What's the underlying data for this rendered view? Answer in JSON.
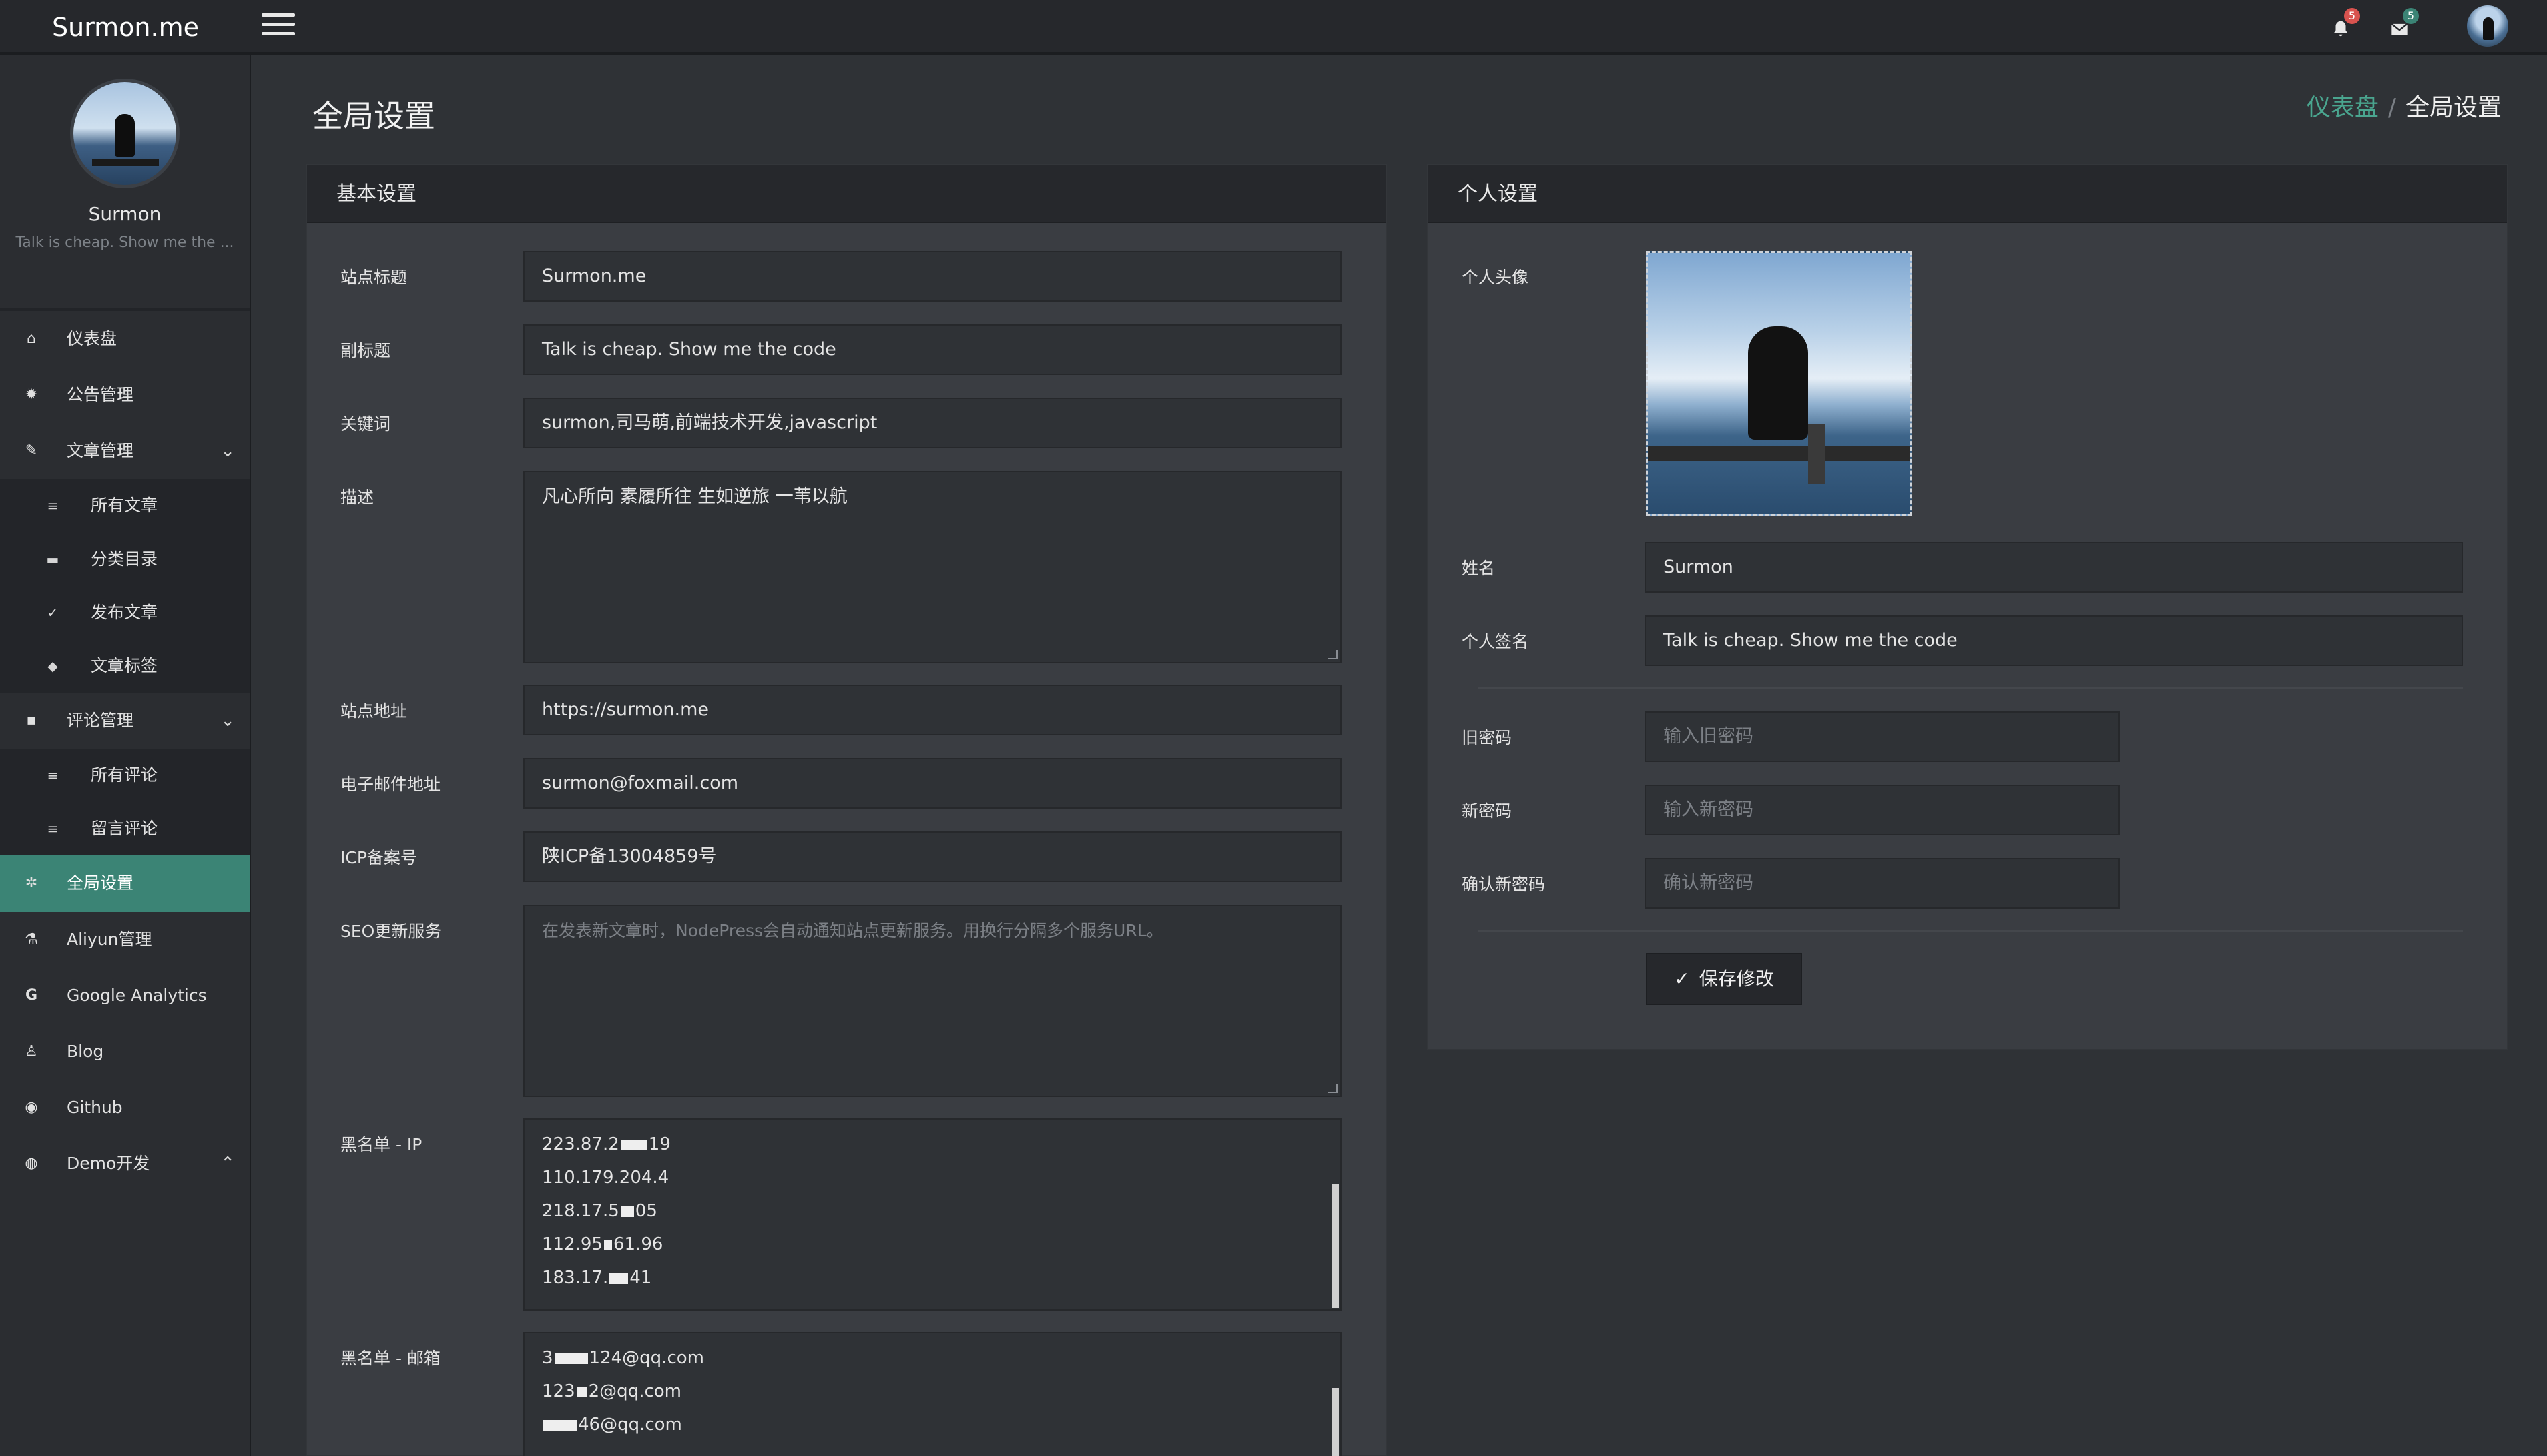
{
  "app": {
    "brand": "Surmon.me"
  },
  "topbar": {
    "notifications_count": "5",
    "messages_count": "5"
  },
  "sidebar": {
    "profile": {
      "name": "Surmon",
      "slogan": "Talk is cheap. Show me the ..."
    },
    "items": [
      {
        "label": "仪表盘",
        "icon": "home-icon"
      },
      {
        "label": "公告管理",
        "icon": "sun-icon"
      },
      {
        "label": "文章管理",
        "icon": "pencil-icon"
      },
      {
        "label": "所有文章",
        "icon": "list-icon"
      },
      {
        "label": "分类目录",
        "icon": "folder-icon"
      },
      {
        "label": "发布文章",
        "icon": "check-icon"
      },
      {
        "label": "文章标签",
        "icon": "tag-icon"
      },
      {
        "label": "评论管理",
        "icon": "comment-icon"
      },
      {
        "label": "所有评论",
        "icon": "list-icon"
      },
      {
        "label": "留言评论",
        "icon": "list-icon"
      },
      {
        "label": "全局设置",
        "icon": "gear-icon"
      },
      {
        "label": "Aliyun管理",
        "icon": "flask-icon"
      },
      {
        "label": "Google Analytics",
        "icon": "google-icon"
      },
      {
        "label": "Blog",
        "icon": "user-icon"
      },
      {
        "label": "Github",
        "icon": "github-icon"
      },
      {
        "label": "Demo开发",
        "icon": "chrome-icon"
      }
    ]
  },
  "page": {
    "title": "全局设置",
    "breadcrumb": {
      "home": "仪表盘",
      "current": "全局设置"
    }
  },
  "basic": {
    "heading": "基本设置",
    "site_title": {
      "label": "站点标题",
      "value": "Surmon.me"
    },
    "subtitle": {
      "label": "副标题",
      "value": "Talk is cheap. Show me the code"
    },
    "keywords": {
      "label": "关键词",
      "value": "surmon,司马萌,前端技术开发,javascript"
    },
    "description": {
      "label": "描述",
      "value": "凡心所向 素履所往 生如逆旅 一苇以航"
    },
    "site_url": {
      "label": "站点地址",
      "value": "https://surmon.me"
    },
    "email": {
      "label": "电子邮件地址",
      "value": "surmon@foxmail.com"
    },
    "icp": {
      "label": "ICP备案号",
      "value": "陕ICP备13004859号"
    },
    "seo": {
      "label": "SEO更新服务",
      "placeholder": "在发表新文章时，NodePress会自动通知站点更新服务。用换行分隔多个服务URL。"
    },
    "blacklist_ip": {
      "label": "黑名单 - IP",
      "lines": [
        "223.87.2",
        "110.179.204.",
        "218.17.5",
        "112.95",
        "183.17."
      ],
      "tails": [
        "19",
        "4",
        "05",
        "61.96",
        "41"
      ]
    },
    "blacklist_email": {
      "label": "黑名单 - 邮箱",
      "lines": [
        "3",
        "123",
        ""
      ],
      "tails": [
        "124@qq.com",
        "2@qq.com",
        "46@qq.com"
      ]
    }
  },
  "personal": {
    "heading": "个人设置",
    "avatar_label": "个人头像",
    "name": {
      "label": "姓名",
      "value": "Surmon"
    },
    "signature": {
      "label": "个人签名",
      "value": "Talk is cheap. Show me the code"
    },
    "old_password": {
      "label": "旧密码",
      "placeholder": "输入旧密码"
    },
    "new_password": {
      "label": "新密码",
      "placeholder": "输入新密码"
    },
    "confirm_password": {
      "label": "确认新密码",
      "placeholder": "确认新密码"
    },
    "save_label": "保存修改"
  },
  "colors": {
    "accent": "#3b8475",
    "link": "#4aa58f",
    "badge_red": "#d9534f",
    "badge_teal": "#3b8475"
  }
}
